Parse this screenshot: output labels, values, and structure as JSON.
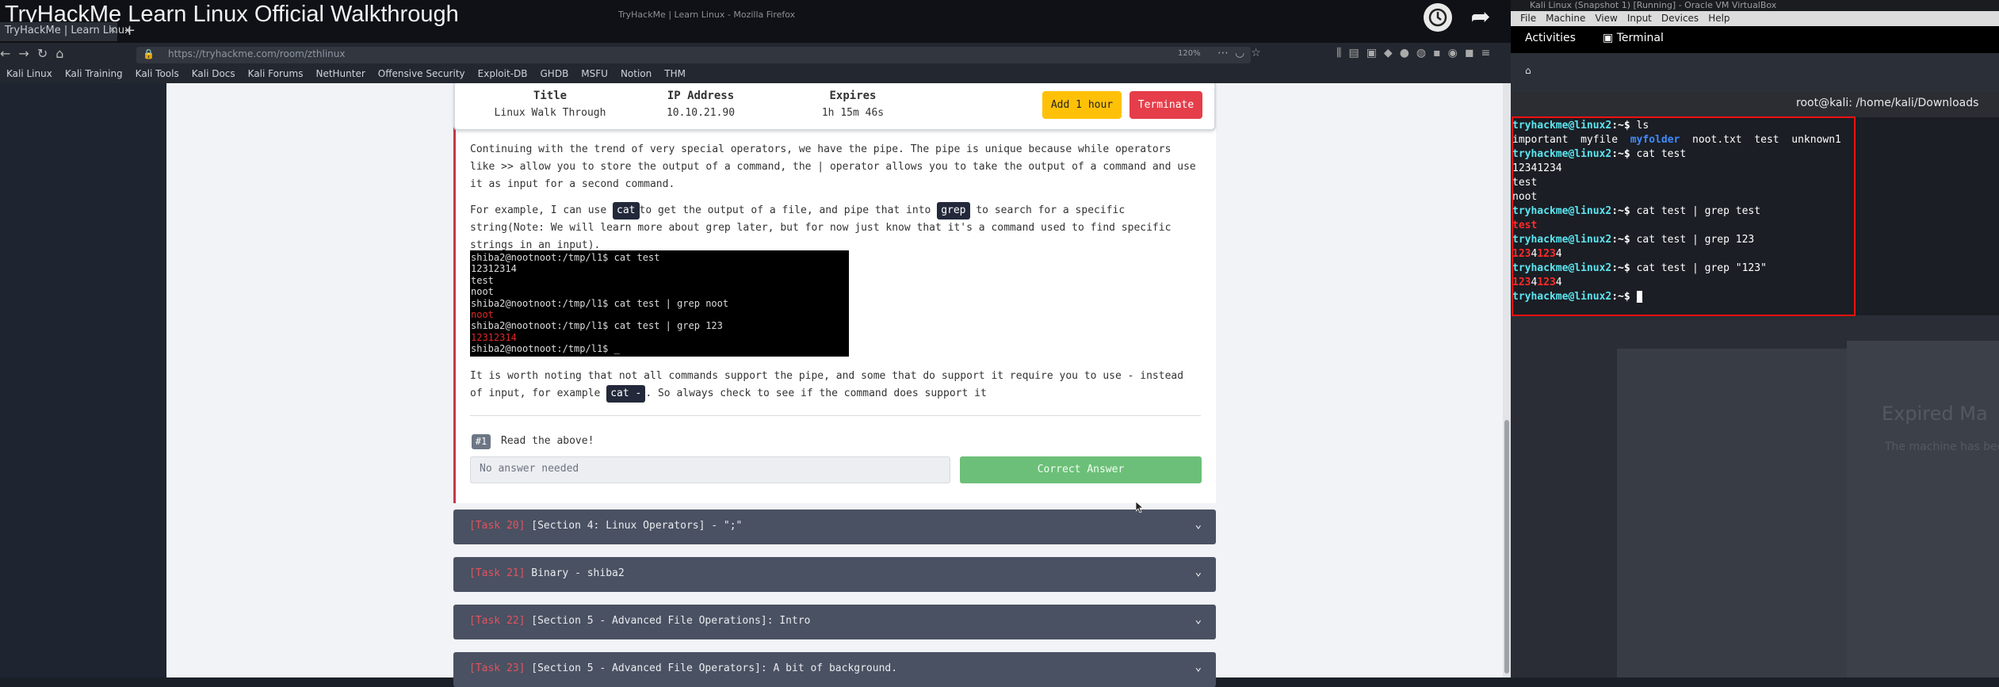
{
  "video": {
    "title": "TryHackMe Learn Linux Official Walkthrough"
  },
  "firefox": {
    "window_title": "TryHackMe | Learn Linux - Mozilla Firefox",
    "tab_label": "TryHackMe | Learn Linux",
    "url": "https://tryhackme.com/room/zthlinux",
    "zoom": "120%",
    "bookmarks": [
      "Kali Linux",
      "Kali Training",
      "Kali Tools",
      "Kali Docs",
      "Kali Forums",
      "NetHunter",
      "Offensive Security",
      "Exploit-DB",
      "GHDB",
      "MSFU",
      "Notion",
      "THM"
    ]
  },
  "vm_panel": {
    "title_header": "Title",
    "title_value": "Linux Walk Through",
    "ip_header": "IP Address",
    "ip_value": "10.10.21.90",
    "expires_header": "Expires",
    "expires_value": "1h 15m 46s",
    "add_hour": "Add 1 hour",
    "terminate": "Terminate"
  },
  "content": {
    "p1": "Continuing with the trend of very special operators, we have the pipe. The pipe is unique because while operators like >> allow you to store the output of a command, the | operator allows you to take the output of a command and use it as input for a second command.",
    "p2_a": "For example, I can use ",
    "p2_code1": "cat",
    "p2_b": "to get the output of a file, and pipe that into ",
    "p2_code2": "grep",
    "p2_c": " to search for a specific string(Note: We will learn more about grep later, but for now just know that it's a command used to find specific strings in an input).",
    "p3_a": "It is worth noting that not all commands support the pipe, and some that do support it require you to use - instead of input, for example ",
    "p3_code": "cat -",
    "p3_b": ". So always check to see if the command does support it",
    "term_lines": [
      "shiba2@nootnoot:/tmp/l1$ cat test",
      "12312314",
      "test",
      "noot",
      "shiba2@nootnoot:/tmp/l1$ cat test | grep noot",
      "noot",
      "shiba2@nootnoot:/tmp/l1$ cat test | grep 123",
      "12312314",
      "shiba2@nootnoot:/tmp/l1$ _"
    ],
    "question_number": "#1",
    "question_text": "Read the above!",
    "answer_placeholder": "No answer needed",
    "correct_label": "Correct Answer"
  },
  "tasks": [
    {
      "num": "[Task 20]",
      "title": "[Section 4: Linux Operators] - \";\""
    },
    {
      "num": "[Task 21]",
      "title": "Binary - shiba2"
    },
    {
      "num": "[Task 22]",
      "title": "[Section 5 - Advanced File Operations]: Intro"
    },
    {
      "num": "[Task 23]",
      "title": "[Section 5 - Advanced File Operators]: A bit of background."
    }
  ],
  "vbox": {
    "window_title": "Kali Linux (Snapshot 1) [Running] - Oracle VM VirtualBox",
    "menu": [
      "File",
      "Machine",
      "View",
      "Input",
      "Devices",
      "Help"
    ],
    "activities": "Activities",
    "app_name": "Terminal",
    "terminal_title": "root@kali: /home/kali/Downloads",
    "prompt": "tryhackme@linux2",
    "prompt_suffix": ":~$ ",
    "cmd1": "ls",
    "ls_out": [
      "important",
      "myfile",
      "myfolder",
      "noot.txt",
      "test",
      "unknown1"
    ],
    "cmd2": "cat test",
    "out2": [
      "12341234",
      "test",
      "noot"
    ],
    "cmd3": "cat test | grep test",
    "out3": "test",
    "cmd4": "cat test | grep 123",
    "cmd5": "cat test | grep \"123\"",
    "out_123": [
      "123",
      "4",
      "123",
      "4"
    ],
    "faded_title": "Expired Ma",
    "faded_sub": "The machine has been terminated"
  },
  "colors": {
    "accent_red": "#e53e4a",
    "add_yellow": "#ffc107",
    "correct_green": "#6cbf78",
    "task_bar": "#4a5162",
    "prompt_cyan": "#5be6f2"
  }
}
